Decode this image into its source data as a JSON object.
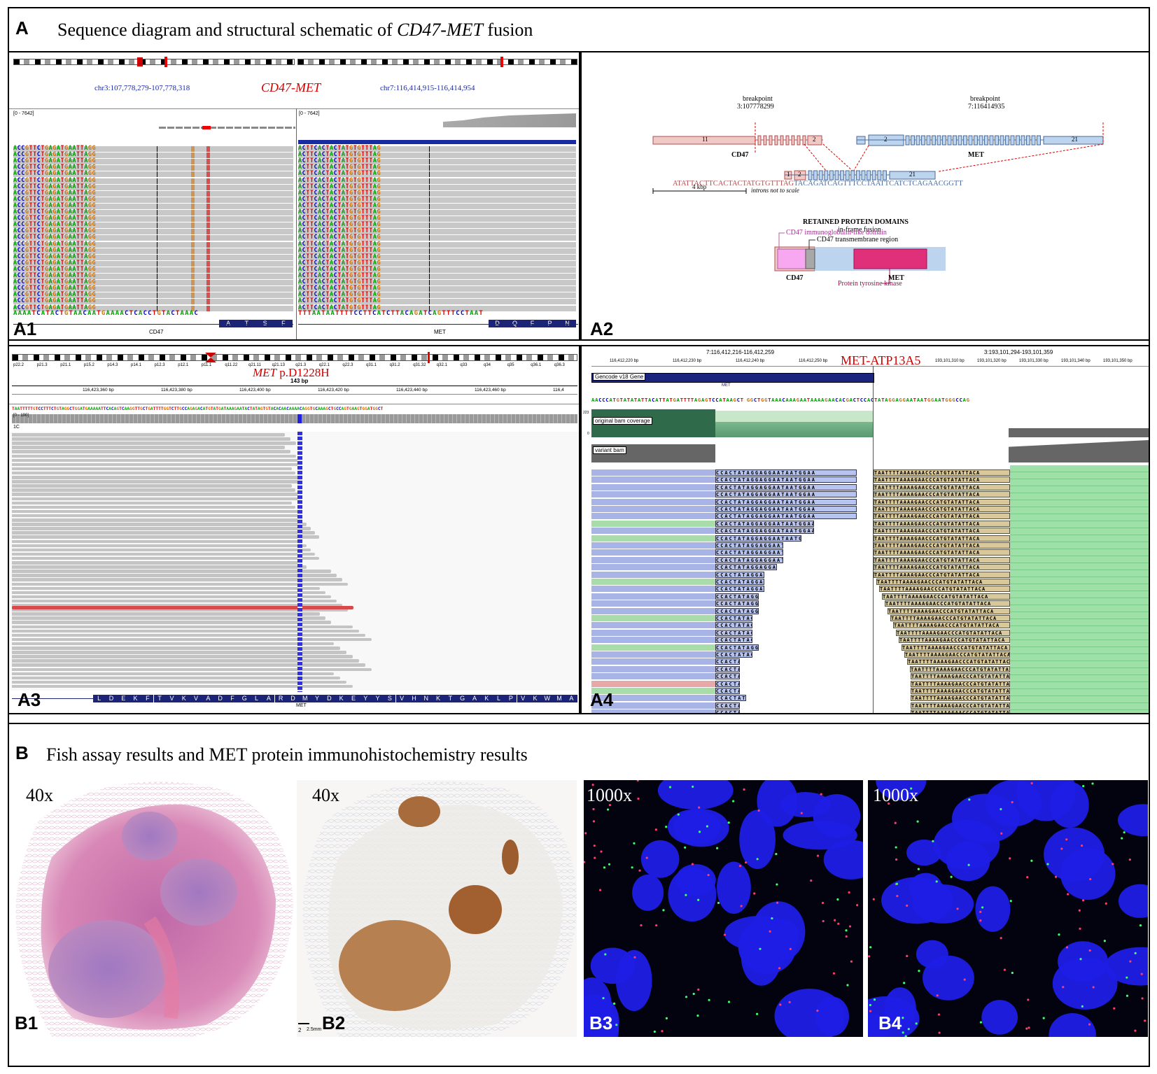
{
  "sectionA": {
    "letter": "A",
    "title_pre": "Sequence diagram and structural schematic of ",
    "title_italic": "CD47-MET",
    "title_post": " fusion"
  },
  "A1": {
    "label": "A1",
    "left_locus": "chr3:107,778,279-107,778,318",
    "fusion_name": "CD47-MET",
    "right_locus": "chr7:116,414,915-116,414,954",
    "left_range": "[0 - 7642]",
    "right_range": "[0 - 7642]",
    "left_read": "ACCGTTCTGAGATGAATTAGG",
    "right_read": "ACTTCACTACTATGTGTTTAG",
    "left_ref": "AAAATCATACTGTAACAATGAAAACTCACCTGTACTAAAC",
    "right_ref": "TTTAATAATTTTCCTTCATCTTACAGATCAGTTTCCTAAT",
    "left_aa": [
      "A",
      "T",
      "S",
      "F"
    ],
    "right_aa": [
      "D",
      "Q",
      "F",
      "P",
      "N"
    ],
    "left_gene": "CD47",
    "right_gene": "MET",
    "colors": {
      "A": "#00a000",
      "C": "#0000c8",
      "G": "#d17105",
      "T": "#e00000",
      "locus": "#1a2aa0",
      "fusion": "#d00000"
    }
  },
  "A2": {
    "label": "A2",
    "bp_left_title": "breakpoint",
    "bp_left_pos": "3:107778299",
    "bp_right_title": "breakpoint",
    "bp_right_pos": "7:116414935",
    "cd47_exon_first": "11",
    "cd47_exon_mid": "2",
    "met_exon_first": "2",
    "met_exon_last": "21",
    "fusion_exon_left": "1",
    "fusion_exon_mid": "2",
    "fusion_exon_last": "21",
    "cd47_label": "CD47",
    "met_label": "MET",
    "junction_left_seq": "ATATTACTTCACTACTATGTGTTTAG",
    "junction_right_seq": "TACAGATCAGTTTCCTAATTCATCTCAGAACGGTT",
    "scale_label": "4 kbp",
    "scale_note": "introns not to scale",
    "domains_title": "RETAINED PROTEIN DOMAINS",
    "domains_subtitle": "in-frame fusion",
    "domain_ig": "CD47 immunoglobulin-like domain",
    "domain_tm": "CD47 transmembrane region",
    "domain_gene_left": "CD47",
    "domain_gene_right": "MET",
    "domain_kinase": "Protein tyrosine kinase",
    "colors": {
      "cd47": "#f0c8c4",
      "cd47_edge": "#b05050",
      "met": "#bcd4ee",
      "met_edge": "#4a6a9a",
      "ig": "#f8a8f0",
      "tm": "#a8a8a8",
      "kinase": "#e0307a"
    }
  },
  "A3": {
    "label": "A3",
    "variant_pre": "MET",
    "variant_post": " p.D1228H",
    "bands": [
      "p22.2",
      "p21.3",
      "p21.1",
      "p15.2",
      "p14.3",
      "p14.1",
      "p12.3",
      "p12.1",
      "p11.1",
      "q11.22",
      "q21.11",
      "q21.13",
      "q21.3",
      "q22.1",
      "q22.3",
      "q31.1",
      "q31.2",
      "q31.32",
      "q32.1",
      "q33",
      "q34",
      "q35",
      "q36.1",
      "q36.3"
    ],
    "span": "143 bp",
    "ticks": [
      "116,423,360 bp",
      "116,423,380 bp",
      "116,423,400 bp",
      "116,423,420 bp",
      "116,423,440 bp",
      "116,423,460 bp",
      "116,4"
    ],
    "ref_seq": "TAATTTTTGTCCTTTCTGTAGGCTGGATGAAAAATTCACAGTCAAGGTTGCTGATTTTGGTCTTGCCAGAGACATGTATGATAAAGAATACTATAGTGTACACAACAAAACAGGTGCAAAGCTGCCAGTGAAGTGGATGGCT",
    "range": "[0 - 190]",
    "track": "1C",
    "aa": [
      "L",
      "D",
      "E",
      "K",
      "F",
      "T",
      "V",
      "K",
      "V",
      "A",
      "D",
      "F",
      "G",
      "L",
      "A",
      "R",
      "D",
      "M",
      "Y",
      "D",
      "K",
      "E",
      "Y",
      "Y",
      "S",
      "V",
      "H",
      "N",
      "K",
      "T",
      "G",
      "A",
      "K",
      "L",
      "P",
      "V",
      "K",
      "W",
      "M",
      "A"
    ],
    "gene": "MET"
  },
  "A4": {
    "label": "A4",
    "title": "MET-ATP13A5",
    "left_locus": "7:116,412,216-116,412,259",
    "right_locus": "3:193,101,294-193,101,359",
    "ticks_left": [
      "116,412,220 bp",
      "116,412,230 bp",
      "116,412,240 bp",
      "116,412,250 bp"
    ],
    "ticks_right": [
      "193,101,310 bp",
      "193,101,320 bp",
      "193,101,330 bp",
      "193,101,340 bp",
      "193,101,350 bp"
    ],
    "gencode": "Gencode v18 Gene",
    "gene": "MET",
    "left_seq": "AACCCATGTATATATTACATTATGATTTTAGAGTCCATAAGCT",
    "right_seq": "GGCTGGTAAACAAAGAATAAAAGAACACGACTCCACTATAGGAGGAATAATGGAATGGGCCAG",
    "coverage1": "original bam coverage",
    "coverage2": "variant bam",
    "cov_range": "223",
    "cov_zero": "0",
    "softclip_left": "CCACTATAGGAGGAATAATGGAA",
    "softclip_right": "TAATTTTAAAAGAACCCATGTATATTACA"
  },
  "sectionB": {
    "letter": "B",
    "title": "Fish assay results and MET protein immunohistochemistry results",
    "panels": [
      {
        "label": "B1",
        "mag": "40x"
      },
      {
        "label": "B2",
        "mag": "40x",
        "scale": "2",
        "scale_unit": "2.5mm"
      },
      {
        "label": "B3",
        "mag": "1000x"
      },
      {
        "label": "B4",
        "mag": "1000x"
      }
    ]
  }
}
